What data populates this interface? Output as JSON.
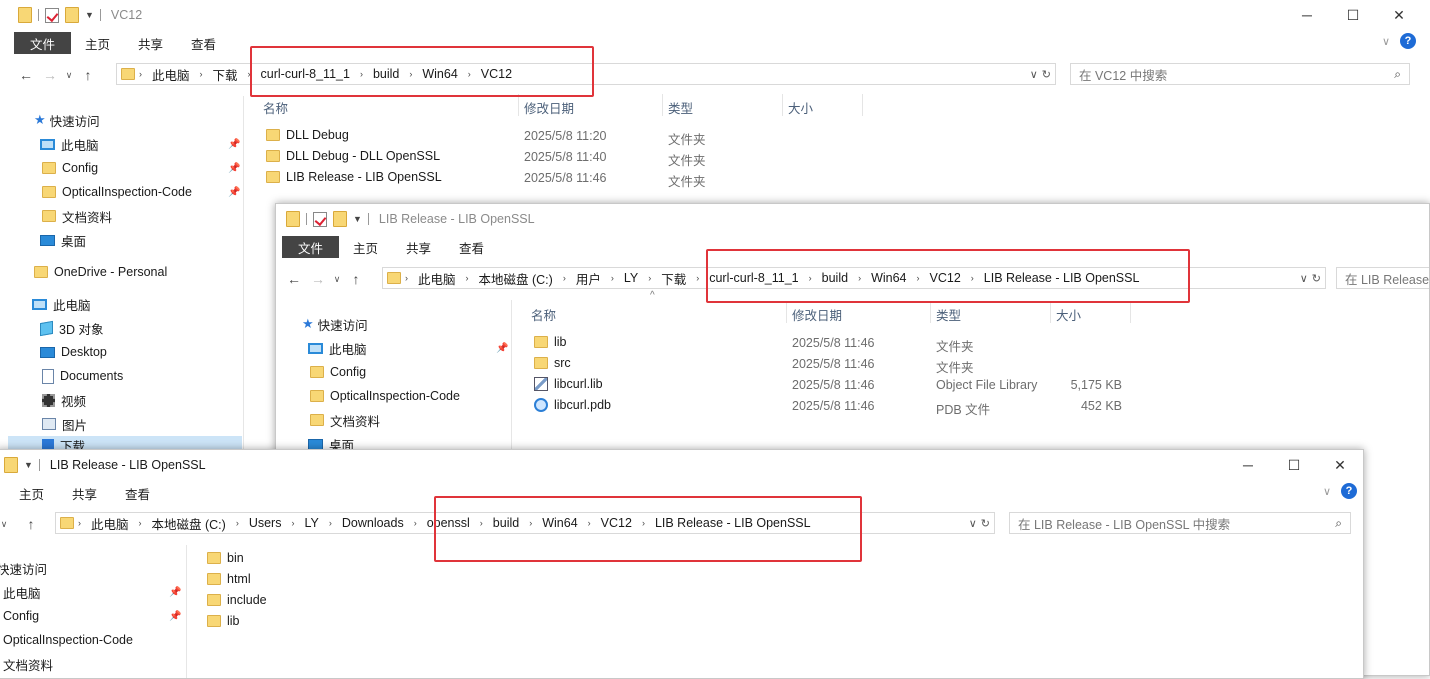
{
  "ribbon": {
    "file": "文件",
    "home": "主页",
    "share": "共享",
    "view": "查看"
  },
  "window1": {
    "title": "VC12",
    "breadcrumb": [
      "此电脑",
      "下载",
      "curl-curl-8_11_1",
      "build",
      "Win64",
      "VC12"
    ],
    "search_placeholder": "在 VC12 中搜索",
    "columns": [
      "名称",
      "修改日期",
      "类型",
      "大小"
    ],
    "sidebar": [
      {
        "label": "快速访问",
        "icon": "star-icon"
      },
      {
        "label": "此电脑",
        "icon": "computer-icon",
        "pinned": true
      },
      {
        "label": "Config",
        "icon": "folder-icon",
        "pinned": true
      },
      {
        "label": "OpticalInspection-Code",
        "icon": "folder-icon",
        "pinned": true
      },
      {
        "label": "文档资料",
        "icon": "folder-icon"
      },
      {
        "label": "桌面",
        "icon": "desktop-icon"
      },
      {
        "label": "OneDrive - Personal",
        "icon": "folder-icon"
      },
      {
        "label": "此电脑",
        "icon": "computer-icon"
      },
      {
        "label": "3D 对象",
        "icon": "3d-objects-icon"
      },
      {
        "label": "Desktop",
        "icon": "desktop-icon"
      },
      {
        "label": "Documents",
        "icon": "documents-icon"
      },
      {
        "label": "视频",
        "icon": "video-icon"
      },
      {
        "label": "图片",
        "icon": "pictures-icon"
      },
      {
        "label": "下载",
        "icon": "downloads-icon"
      }
    ],
    "files": [
      {
        "name": "DLL Debug",
        "date": "2025/5/8 11:20",
        "type": "文件夹",
        "size": ""
      },
      {
        "name": "DLL Debug - DLL OpenSSL",
        "date": "2025/5/8 11:40",
        "type": "文件夹",
        "size": ""
      },
      {
        "name": "LIB Release - LIB OpenSSL",
        "date": "2025/5/8 11:46",
        "type": "文件夹",
        "size": ""
      }
    ]
  },
  "window2": {
    "title": "LIB Release - LIB OpenSSL",
    "breadcrumb": [
      "此电脑",
      "本地磁盘 (C:)",
      "用户",
      "LY",
      "下载",
      "curl-curl-8_11_1",
      "build",
      "Win64",
      "VC12",
      "LIB Release - LIB OpenSSL"
    ],
    "search_placeholder": "在 LIB Release",
    "columns": [
      "名称",
      "修改日期",
      "类型",
      "大小"
    ],
    "sidebar": [
      {
        "label": "快速访问",
        "icon": "star-icon"
      },
      {
        "label": "此电脑",
        "icon": "computer-icon",
        "pinned": true
      },
      {
        "label": "Config",
        "icon": "folder-icon"
      },
      {
        "label": "OpticalInspection-Code",
        "icon": "folder-icon"
      },
      {
        "label": "文档资料",
        "icon": "folder-icon"
      },
      {
        "label": "桌面",
        "icon": "desktop-icon"
      }
    ],
    "files": [
      {
        "name": "lib",
        "date": "2025/5/8 11:46",
        "type": "文件夹",
        "size": "",
        "icon": "folder-icon"
      },
      {
        "name": "src",
        "date": "2025/5/8 11:46",
        "type": "文件夹",
        "size": "",
        "icon": "folder-icon"
      },
      {
        "name": "libcurl.lib",
        "date": "2025/5/8 11:46",
        "type": "Object File Library",
        "size": "5,175 KB",
        "icon": "lib-file-icon"
      },
      {
        "name": "libcurl.pdb",
        "date": "2025/5/8 11:46",
        "type": "PDB 文件",
        "size": "452 KB",
        "icon": "pdb-file-icon"
      }
    ]
  },
  "window3": {
    "title": "LIB Release - LIB OpenSSL",
    "breadcrumb": [
      "此电脑",
      "本地磁盘 (C:)",
      "Users",
      "LY",
      "Downloads",
      "openssl",
      "build",
      "Win64",
      "VC12",
      "LIB Release - LIB OpenSSL"
    ],
    "search_placeholder": "在 LIB Release - LIB OpenSSL 中搜索",
    "sidebar": [
      {
        "label": "快速访问",
        "icon": "star-icon"
      },
      {
        "label": "此电脑",
        "icon": "computer-icon",
        "pinned": true
      },
      {
        "label": "Config",
        "icon": "folder-icon",
        "pinned": true
      },
      {
        "label": "OpticalInspection-Code",
        "icon": "folder-icon"
      },
      {
        "label": "文档资料",
        "icon": "folder-icon"
      }
    ],
    "files": [
      {
        "name": "bin"
      },
      {
        "name": "html"
      },
      {
        "name": "include"
      },
      {
        "name": "lib"
      }
    ]
  },
  "colors": {
    "highlight": "#e0343a",
    "file_tab": "#444444",
    "help": "#1e6bd6"
  }
}
